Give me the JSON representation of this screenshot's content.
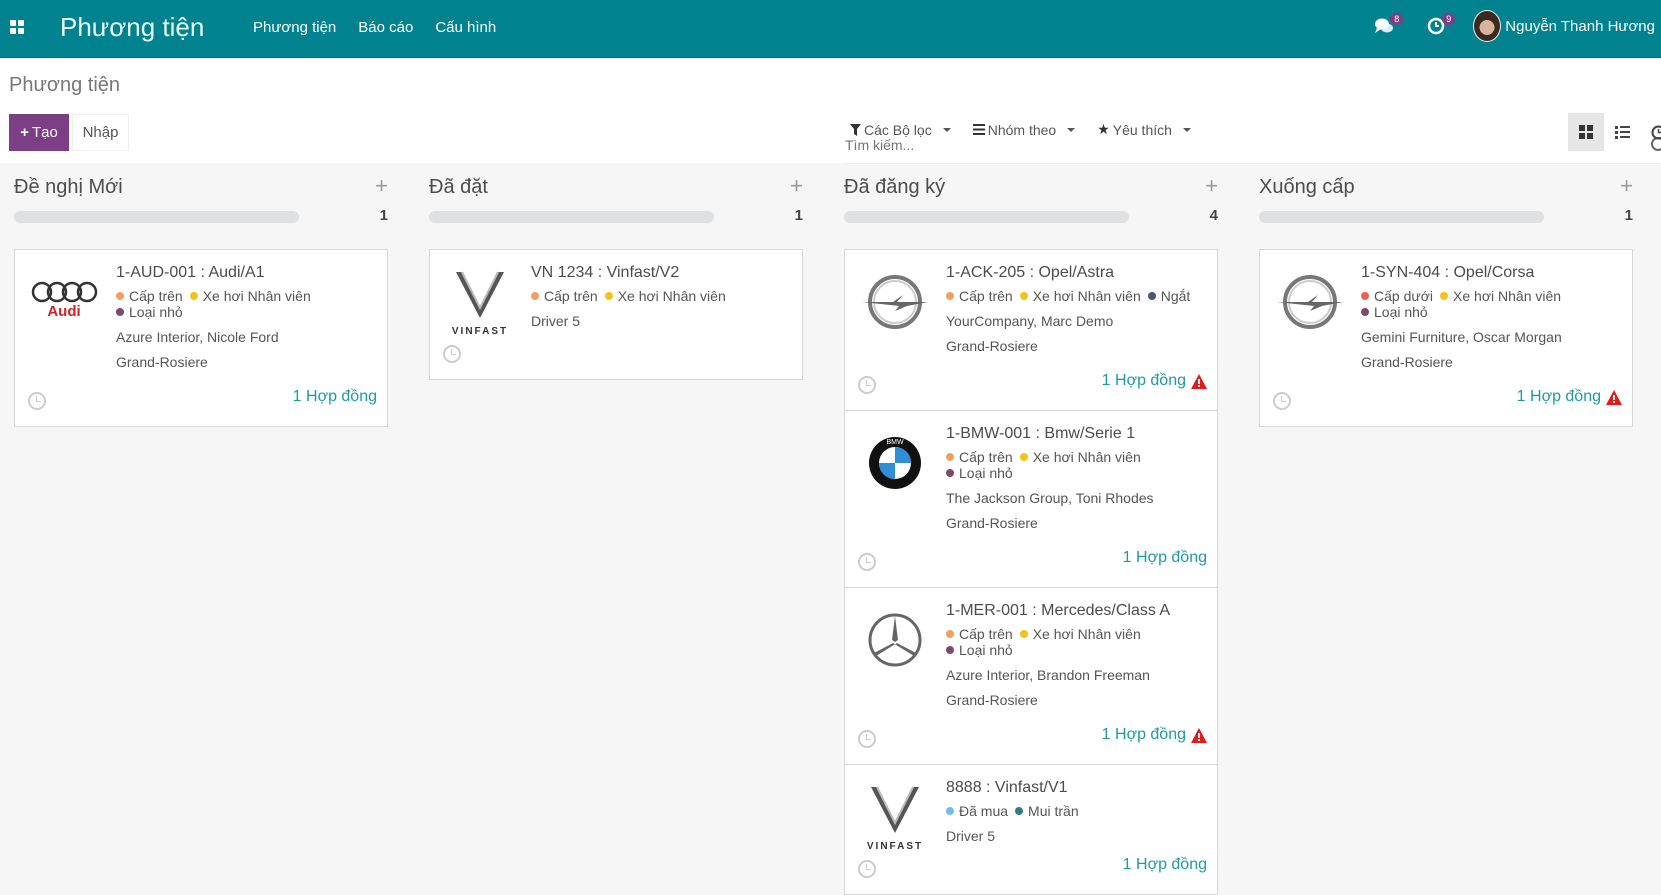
{
  "navbar": {
    "app_title": "Phương tiện",
    "menu": [
      "Phương tiện",
      "Báo cáo",
      "Cấu hình"
    ],
    "messages_count": "8",
    "activities_count": "9",
    "user_name": "Nguyễn Thanh Hương"
  },
  "control_panel": {
    "breadcrumb": "Phương tiện",
    "create_label": "Tạo",
    "import_label": "Nhập",
    "search_placeholder": "Tìm kiếm...",
    "filters_label": "Các Bộ lọc",
    "groupby_label": "Nhóm theo",
    "favorites_label": "Yêu thích"
  },
  "colors": {
    "brand": "#00838f",
    "primary": "#7c3f85",
    "link": "#1f9aa0",
    "warning": "#e01b1b"
  },
  "columns": [
    {
      "title": "Đề nghị Mới",
      "count": "1",
      "cards": [
        {
          "logo": "audi",
          "logo_text": "Audi",
          "title": "1-AUD-001 : Audi/A1",
          "tags": [
            {
              "label": "Cấp trên",
              "color": "#f0a060"
            },
            {
              "label": "Xe hơi Nhân viên",
              "color": "#f2c318"
            },
            {
              "label": "Loại nhỏ",
              "color": "#7d4a6a"
            }
          ],
          "lines": [
            "Azure Interior, Nicole Ford",
            "Grand-Rosiere"
          ],
          "contracts": "1 Hợp đồng",
          "warning": false
        }
      ]
    },
    {
      "title": "Đã đặt",
      "count": "1",
      "cards": [
        {
          "logo": "vinfast",
          "logo_text": "VINFAST",
          "title": "VN 1234 : Vinfast/V2",
          "tags": [
            {
              "label": "Cấp trên",
              "color": "#f0a060"
            },
            {
              "label": "Xe hơi Nhân viên",
              "color": "#f2c318"
            }
          ],
          "lines": [
            "Driver 5"
          ],
          "contracts": "",
          "warning": false
        }
      ]
    },
    {
      "title": "Đã đăng ký",
      "count": "4",
      "cards": [
        {
          "logo": "opel",
          "logo_text": "",
          "title": "1-ACK-205 : Opel/Astra",
          "tags": [
            {
              "label": "Cấp trên",
              "color": "#f0a060"
            },
            {
              "label": "Xe hơi Nhân viên",
              "color": "#f2c318"
            },
            {
              "label": "Ngắt",
              "color": "#4a5478"
            }
          ],
          "lines": [
            "YourCompany, Marc Demo",
            "Grand-Rosiere"
          ],
          "contracts": "1 Hợp đồng",
          "warning": true
        },
        {
          "logo": "bmw",
          "logo_text": "BMW",
          "title": "1-BMW-001 : Bmw/Serie 1",
          "tags": [
            {
              "label": "Cấp trên",
              "color": "#f0a060"
            },
            {
              "label": "Xe hơi Nhân viên",
              "color": "#f2c318"
            },
            {
              "label": "Loại nhỏ",
              "color": "#7d4a6a"
            }
          ],
          "lines": [
            "The Jackson Group, Toni Rhodes",
            "Grand-Rosiere"
          ],
          "contracts": "1 Hợp đồng",
          "warning": false
        },
        {
          "logo": "mercedes",
          "logo_text": "",
          "title": "1-MER-001 : Mercedes/Class A",
          "tags": [
            {
              "label": "Cấp trên",
              "color": "#f0a060"
            },
            {
              "label": "Xe hơi Nhân viên",
              "color": "#f2c318"
            },
            {
              "label": "Loại nhỏ",
              "color": "#7d4a6a"
            }
          ],
          "lines": [
            "Azure Interior, Brandon Freeman",
            "Grand-Rosiere"
          ],
          "contracts": "1 Hợp đồng",
          "warning": true
        },
        {
          "logo": "vinfast",
          "logo_text": "VINFAST",
          "title": "8888 : Vinfast/V1",
          "tags": [
            {
              "label": "Đã mua",
              "color": "#6cc1ed"
            },
            {
              "label": "Mui trần",
              "color": "#2c7f8a"
            }
          ],
          "lines": [
            "Driver 5"
          ],
          "contracts": "1 Hợp đồng",
          "warning": false
        }
      ]
    },
    {
      "title": "Xuống cấp",
      "count": "1",
      "cards": [
        {
          "logo": "opel",
          "logo_text": "",
          "title": "1-SYN-404 : Opel/Corsa",
          "tags": [
            {
              "label": "Cấp dưới",
              "color": "#f06050"
            },
            {
              "label": "Xe hơi Nhân viên",
              "color": "#f2c318"
            },
            {
              "label": "Loại nhỏ",
              "color": "#7d4a6a"
            }
          ],
          "lines": [
            "Gemini Furniture, Oscar Morgan",
            "Grand-Rosiere"
          ],
          "contracts": "1 Hợp đồng",
          "warning": true
        }
      ]
    }
  ]
}
